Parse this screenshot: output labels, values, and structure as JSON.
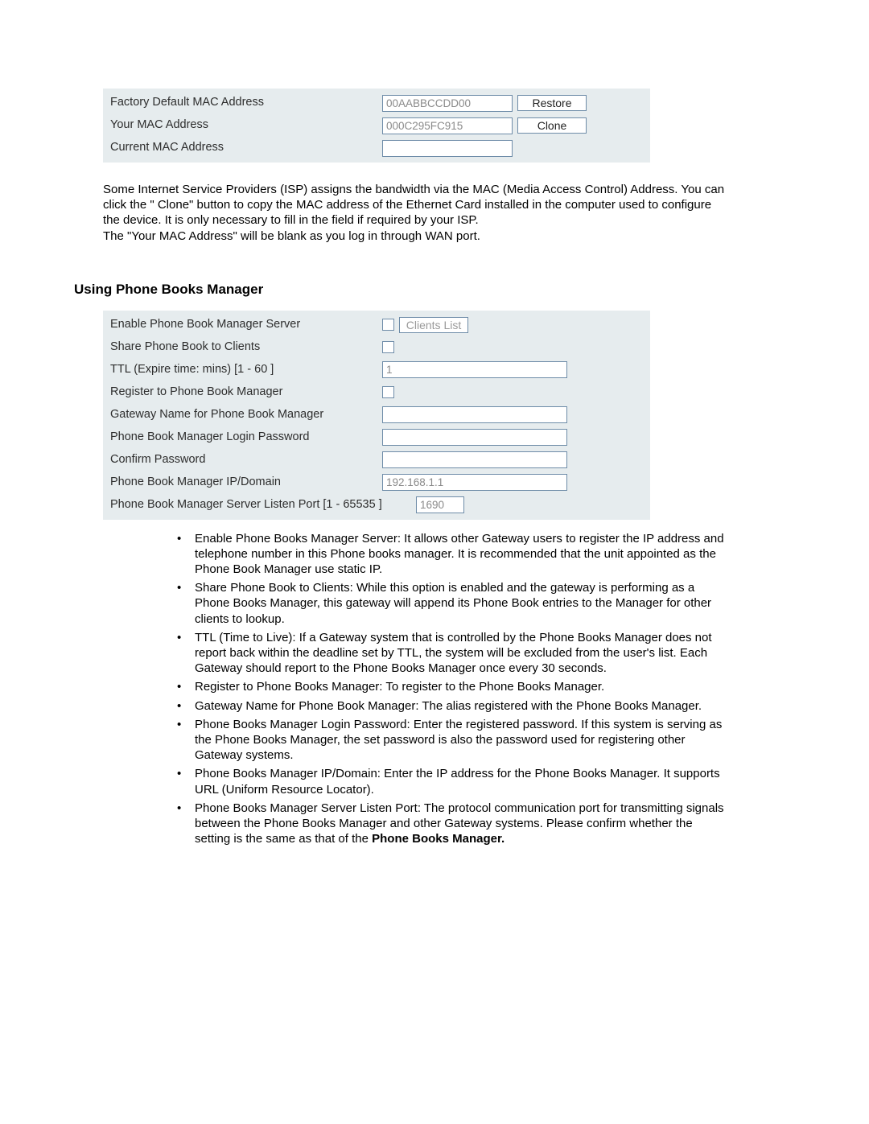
{
  "mac": {
    "rows": {
      "factory": {
        "label": "Factory Default MAC Address",
        "value": "00AABBCCDD00",
        "button": "Restore"
      },
      "your": {
        "label": "Your MAC Address",
        "value": "000C295FC915",
        "button": "Clone"
      },
      "current": {
        "label": "Current MAC Address",
        "value": ""
      }
    },
    "paragraph_a": "Some Internet Service Providers (ISP) assigns the bandwidth via the MAC (Media Access Control) Address. You can click the \" Clone\" button to copy the MAC address of the Ethernet Card installed in the computer used to configure the device. It is only necessary to fill in the field if required by your ISP.",
    "paragraph_b": "The \"Your MAC Address\" will be blank as you log in through WAN port."
  },
  "heading": "Using Phone Books Manager",
  "pbm": {
    "enable": {
      "label": "Enable Phone Book Manager Server",
      "button": "Clients List"
    },
    "share": {
      "label": "Share Phone Book to Clients"
    },
    "ttl": {
      "label": "TTL (Expire time: mins) [1 - 60 ]",
      "value": "1"
    },
    "register": {
      "label": "Register to Phone Book Manager"
    },
    "gwname": {
      "label": "Gateway Name for Phone Book Manager",
      "value": ""
    },
    "loginpw": {
      "label": "Phone Book Manager Login Password",
      "value": ""
    },
    "confirmpw": {
      "label": "Confirm Password",
      "value": ""
    },
    "ipdomain": {
      "label": "Phone Book Manager IP/Domain",
      "value": "192.168.1.1"
    },
    "listenport": {
      "label": "Phone Book Manager Server Listen Port [1 - 65535 ]",
      "value": "1690"
    }
  },
  "bullets": {
    "b1": "Enable Phone Books Manager Server: It allows other Gateway users to register the IP address and telephone number in this Phone books manager. It is recommended that the unit appointed as the Phone Book Manager use static IP.",
    "b2": "Share Phone Book to Clients: While this option is enabled and the gateway is performing as a Phone Books Manager, this gateway will append its Phone Book entries to the Manager for other clients to lookup.",
    "b3": "TTL (Time to Live): If a Gateway system that is controlled by the Phone Books Manager does not report back within the deadline set by TTL, the system will be excluded from the user's list. Each Gateway should report to the Phone Books Manager once every 30 seconds.",
    "b4": "Register to Phone Books Manager: To register to the Phone Books Manager.",
    "b5": "Gateway Name for Phone Book Manager: The alias registered with the Phone Books Manager.",
    "b6": "Phone Books Manager Login Password: Enter the registered password. If this system is serving as the Phone Books Manager, the set password is also the password used for registering other Gateway systems.",
    "b7": "Phone Books Manager IP/Domain: Enter the IP address for the Phone Books Manager. It supports URL (Uniform Resource Locator).",
    "b8a": "Phone Books Manager Server Listen Port: The protocol communication port for transmitting signals between the Phone Books Manager and other Gateway systems.   Please confirm whether the setting is the same as that of the ",
    "b8b": "Phone Books Manager."
  }
}
